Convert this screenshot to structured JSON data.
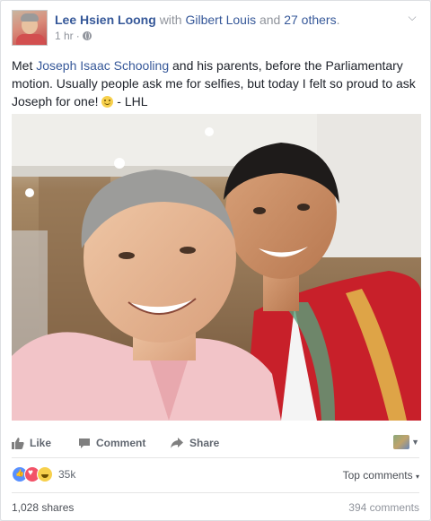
{
  "post": {
    "author": "Lee Hsien Loong",
    "with_word": "with",
    "tagged_name": "Gilbert Louis",
    "and_word": "and",
    "others": "27 others",
    "period": ".",
    "timestamp": "1 hr",
    "separator": "·",
    "privacy_icon": "globe-icon",
    "menu_icon": "chevron-down-icon",
    "text_before": "Met ",
    "mention": "Joseph Isaac Schooling",
    "text_after": " and his parents, before the Parliamentary motion. Usually people ask me for selfies, but today I felt so proud to ask Joseph for one! ",
    "emoji": "smiley-icon",
    "signoff": " - LHL"
  },
  "actions": {
    "like_label": "Like",
    "comment_label": "Comment",
    "share_label": "Share",
    "like_icon": "thumbs-up-icon",
    "comment_icon": "comment-bubble-icon",
    "share_icon": "share-arrow-icon"
  },
  "stats": {
    "reactions_count": "35k",
    "reaction_icons": [
      "like-reaction-icon",
      "love-reaction-icon",
      "haha-reaction-icon"
    ],
    "top_comments_label": "Top comments",
    "caret": "▾",
    "shares": "1,028 shares",
    "comments": "394 comments"
  },
  "colors": {
    "link": "#365899",
    "meta_grey": "#90949c",
    "action_grey": "#616770",
    "jacket_red": "#c8202a",
    "shirt_pink": "#f2c4c8"
  }
}
